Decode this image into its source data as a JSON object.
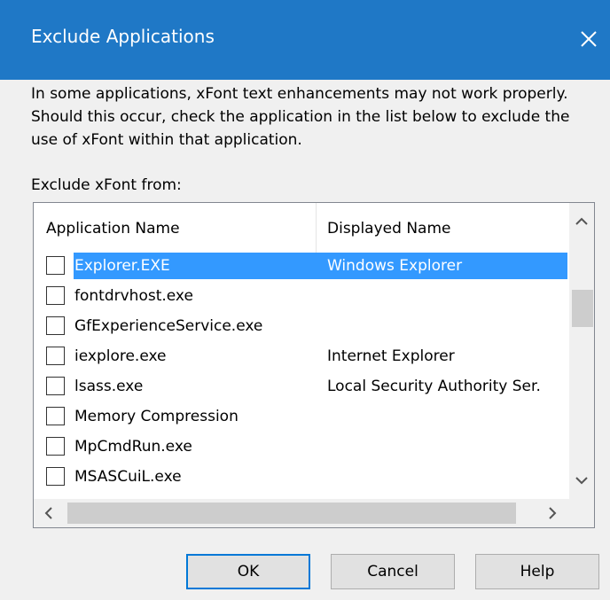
{
  "dialog": {
    "title": "Exclude Applications",
    "description": "In some applications, xFont text enhancements may not work properly.  Should this occur, check the application in the list below to exclude the use of xFont within that application.",
    "list_label": "Exclude xFont from:"
  },
  "list": {
    "columns": [
      "Application Name",
      "Displayed Name"
    ],
    "rows": [
      {
        "app": "Explorer.EXE",
        "display": "Windows Explorer",
        "checked": false,
        "selected": true
      },
      {
        "app": "fontdrvhost.exe",
        "display": "",
        "checked": false,
        "selected": false
      },
      {
        "app": "GfExperienceService.exe",
        "display": "",
        "checked": false,
        "selected": false
      },
      {
        "app": "iexplore.exe",
        "display": "Internet Explorer",
        "checked": false,
        "selected": false
      },
      {
        "app": "lsass.exe",
        "display": "Local Security Authority Ser.",
        "checked": false,
        "selected": false
      },
      {
        "app": "Memory Compression",
        "display": "",
        "checked": false,
        "selected": false
      },
      {
        "app": "MpCmdRun.exe",
        "display": "",
        "checked": false,
        "selected": false
      },
      {
        "app": "MSASCuiL.exe",
        "display": "",
        "checked": false,
        "selected": false
      }
    ]
  },
  "buttons": {
    "ok": "OK",
    "cancel": "Cancel",
    "help": "Help"
  },
  "colors": {
    "titlebar": "#1f78c6",
    "selection": "#3399ff",
    "default_button_border": "#0078d7"
  },
  "icons": {
    "close": "close-icon",
    "scroll_up": "chevron-up-icon",
    "scroll_down": "chevron-down-icon",
    "scroll_left": "chevron-left-icon",
    "scroll_right": "chevron-right-icon"
  }
}
